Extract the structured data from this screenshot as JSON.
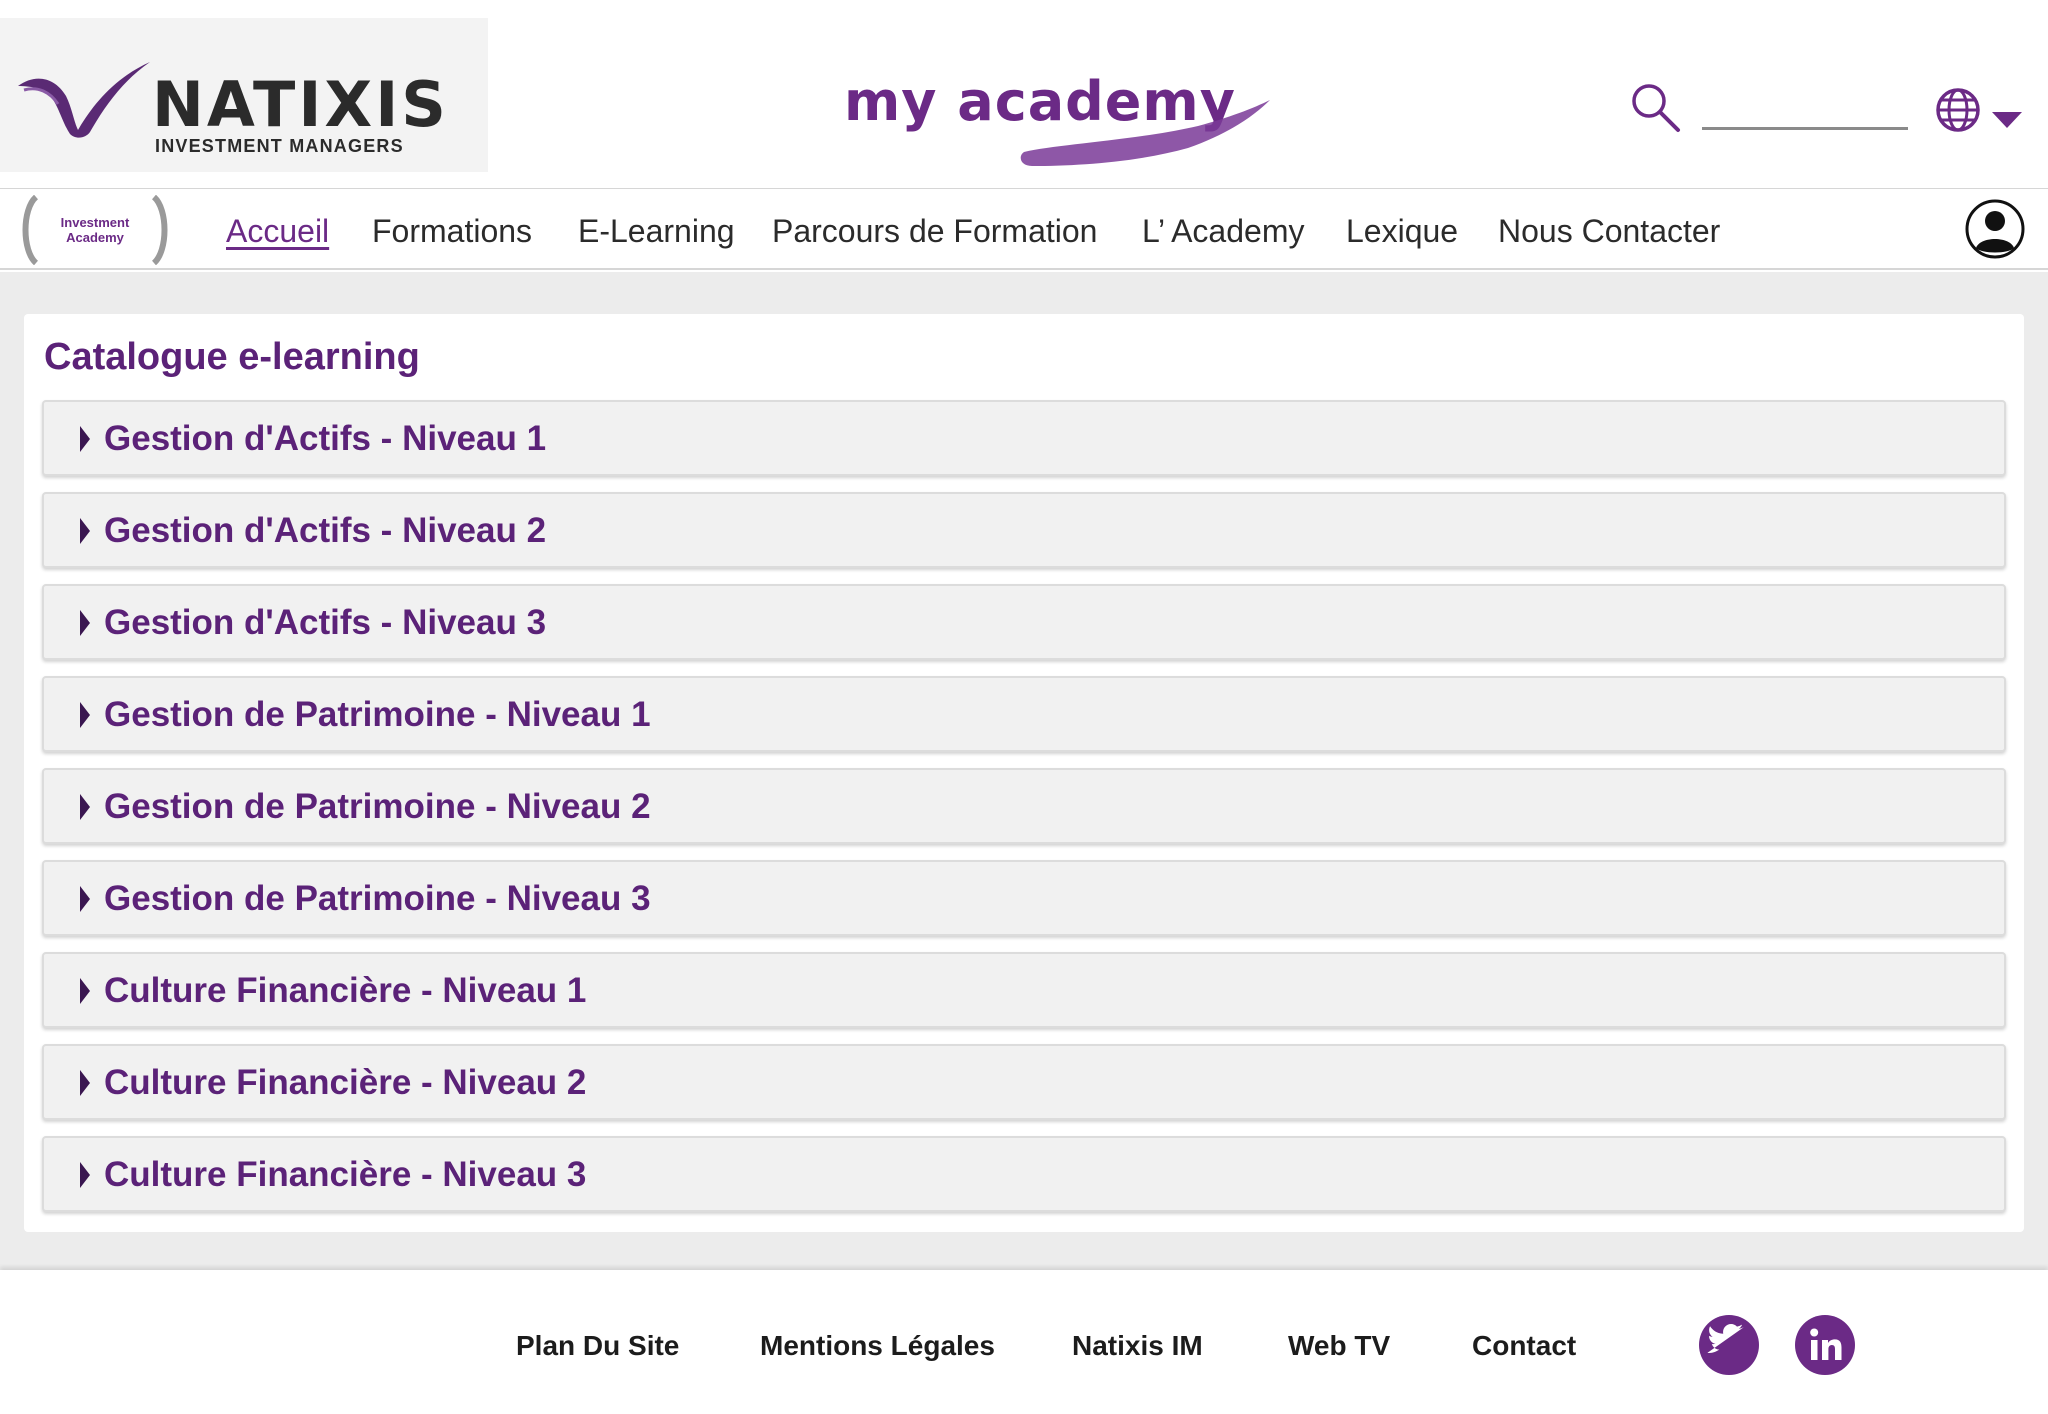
{
  "header": {
    "logo_brand": "NATIXIS",
    "logo_sub": "INVESTMENT MANAGERS",
    "center_brand": "my academy",
    "search": {
      "placeholder": "",
      "value": ""
    },
    "lang_icon": "globe-icon"
  },
  "nav": {
    "badge": {
      "line1": "Investment",
      "line2": "Academy"
    },
    "items": [
      {
        "label": "Accueil",
        "active": true
      },
      {
        "label": "Formations"
      },
      {
        "label": "E-Learning"
      },
      {
        "label": "Parcours de Formation"
      },
      {
        "label": "L’ Academy"
      },
      {
        "label": "Lexique"
      },
      {
        "label": "Nous Contacter"
      }
    ],
    "user_icon": "user-account-icon"
  },
  "catalog": {
    "title": "Catalogue e-learning",
    "items": [
      "Gestion d'Actifs - Niveau 1",
      "Gestion d'Actifs - Niveau 2",
      "Gestion d'Actifs - Niveau 3",
      "Gestion de Patrimoine - Niveau 1",
      "Gestion de Patrimoine - Niveau 2",
      "Gestion de Patrimoine - Niveau 3",
      "Culture Financière - Niveau 1",
      "Culture Financière - Niveau 2",
      "Culture Financière - Niveau 3"
    ]
  },
  "footer": {
    "links": [
      "Plan Du Site",
      "Mentions Légales",
      "Natixis IM",
      "Web TV",
      "Contact"
    ],
    "social": [
      "twitter-icon",
      "linkedin-icon"
    ]
  },
  "colors": {
    "brand_purple": "#6b2a86",
    "title_purple": "#5b2278",
    "accordion_bg": "#f1f1f1",
    "page_bg": "#ececec"
  }
}
